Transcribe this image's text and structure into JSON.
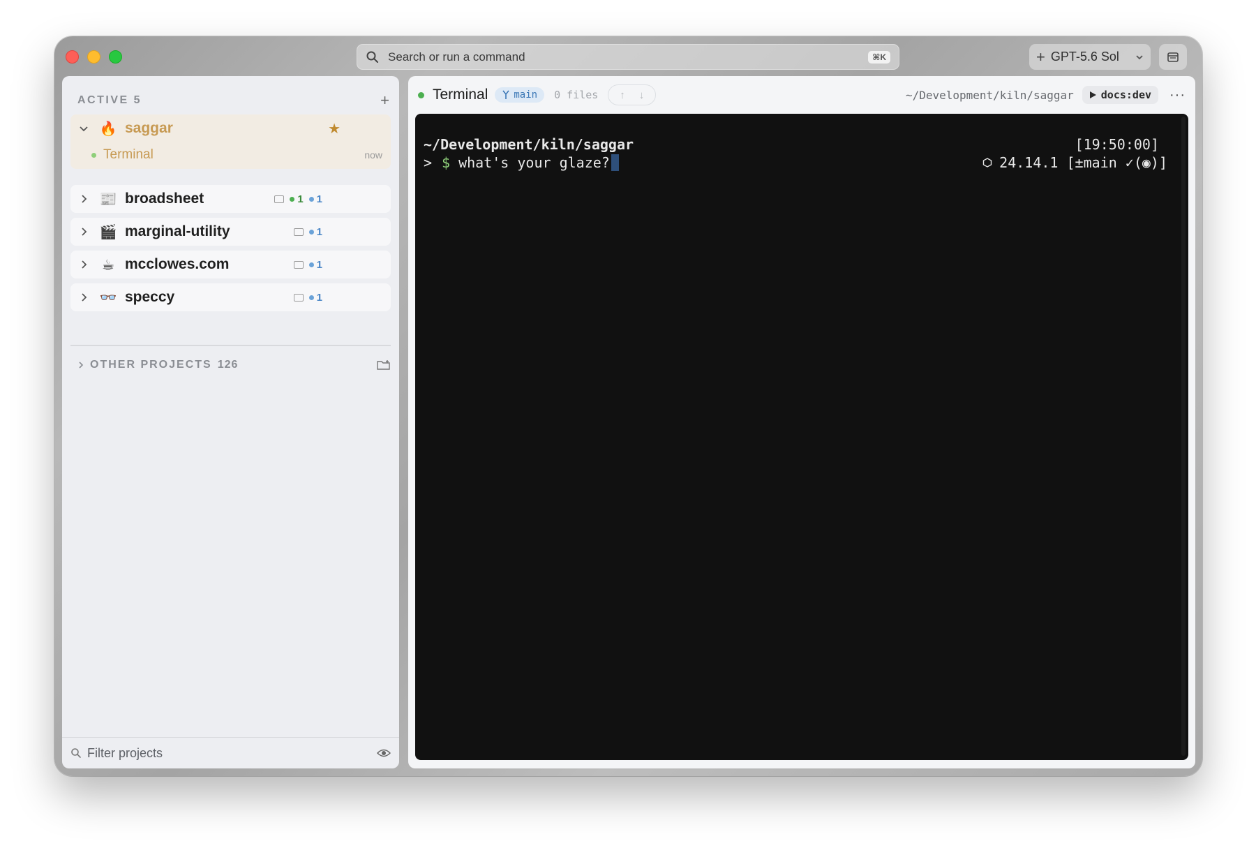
{
  "window": {
    "command_bar": {
      "placeholder": "Search or run a command",
      "shortcut": "⌘K"
    },
    "model": {
      "label": "GPT-5.6 Sol"
    }
  },
  "sidebar": {
    "header": {
      "title": "ACTIVE 5",
      "add_label": "+"
    },
    "projects": [
      {
        "name": "saggar",
        "emoji": "🔥",
        "expanded": true,
        "starred": true,
        "session": {
          "label": "Terminal",
          "time": "now"
        }
      },
      {
        "name": "broadsheet",
        "emoji": "📰",
        "green_count": "1",
        "blue_count": "1"
      },
      {
        "name": "marginal-utility",
        "emoji": "🎬",
        "blue_count": "1"
      },
      {
        "name": "mcclowes.com",
        "emoji": "☕",
        "blue_count": "1"
      },
      {
        "name": "speccy",
        "emoji": "👓",
        "blue_count": "1"
      }
    ],
    "other_projects": {
      "label": "OTHER PROJECTS",
      "count": "126"
    },
    "filter": {
      "placeholder": "Filter projects"
    }
  },
  "main": {
    "title": "Terminal",
    "branch": "main",
    "files": "0 files",
    "path": "~/Development/kiln/saggar",
    "run_label": "docs:dev",
    "more": "···",
    "terminal": {
      "cwd": "~/Development/kiln/saggar",
      "time": "[19:50:00]",
      "prompt_arrow": ">",
      "prompt_symbol": "$",
      "input": "what's your glaze?",
      "node_version": "24.14.1",
      "git_status": "[±main ✓(◉)]"
    }
  },
  "colors": {
    "accent": "#c79a53",
    "active_bg": "#f2ece3",
    "terminal_bg": "#111111",
    "branch_blue": "#3c78b6"
  }
}
